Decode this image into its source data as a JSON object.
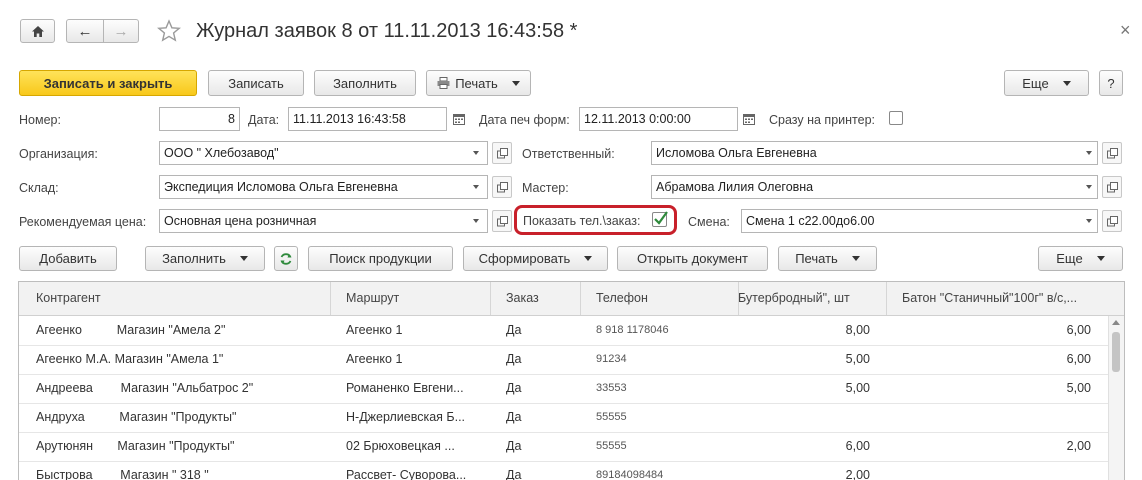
{
  "window": {
    "title": "Журнал заявок 8 от 11.11.2013 16:43:58 *",
    "close_glyph": "×",
    "back_glyph": "←",
    "forward_glyph": "→"
  },
  "toolbar": {
    "save_close": "Записать и закрыть",
    "save": "Записать",
    "fill": "Заполнить",
    "print": "Печать",
    "more": "Еще",
    "help": "?"
  },
  "form": {
    "number_label": "Номер:",
    "number_value": "8",
    "date_label": "Дата:",
    "date_value": "11.11.2013 16:43:58",
    "print_date_label": "Дата печ форм:",
    "print_date_value": "12.11.2013  0:00:00",
    "to_printer_label": "Сразу на принтер:",
    "org_label": "Организация:",
    "org_value": "ООО \" Хлебозавод\"",
    "responsible_label": "Ответственный:",
    "responsible_value": "Исломова Ольга Евгеневна",
    "warehouse_label": "Склад:",
    "warehouse_value": "Экспедиция Исломова Ольга Евгеневна",
    "master_label": "Мастер:",
    "master_value": "Абрамова Лилия Олеговна",
    "price_label": "Рекомендуемая цена:",
    "price_value": "Основная цена розничная",
    "show_phone_label": "Показать тел.\\заказ:",
    "shift_label": "Смена:",
    "shift_value": "Смена 1 с22.00до6.00"
  },
  "table_toolbar": {
    "add": "Добавить",
    "fill": "Заполнить",
    "search_products": "Поиск продукции",
    "generate": "Сформировать",
    "open_document": "Открыть документ",
    "print": "Печать",
    "more": "Еще"
  },
  "table": {
    "columns": [
      "Контрагент",
      "Маршрут",
      "Заказ",
      "Телефон",
      "Бутербродный\", шт",
      "Батон \"Станичный\"100г\" в/с,..."
    ],
    "rows": [
      {
        "contractor": "Агеенко          Магазин \"Амела 2\"",
        "route": "Агеенко 1",
        "order": "Да",
        "phone": "8 918 1178046",
        "c1": "8,00",
        "c2": "6,00"
      },
      {
        "contractor": "Агеенко М.А. Магазин \"Амела 1\"",
        "route": "Агеенко 1",
        "order": "Да",
        "phone": "91234",
        "c1": "5,00",
        "c2": "6,00"
      },
      {
        "contractor": "Андреева        Магазин \"Альбатрос 2\"",
        "route": "Романенко Евгени...",
        "order": "Да",
        "phone": "33553",
        "c1": "5,00",
        "c2": "5,00"
      },
      {
        "contractor": "Андруха          Магазин \"Продукты\"",
        "route": "Н-Джерлиевская Б...",
        "order": "Да",
        "phone": "55555",
        "c1": "",
        "c2": ""
      },
      {
        "contractor": "Арутюнян       Магазин \"Продукты\"",
        "route": "02 Брюховецкая   ...",
        "order": "Да",
        "phone": "55555",
        "c1": "6,00",
        "c2": "2,00"
      },
      {
        "contractor": "Быстрова        Магазин \" 318 \"",
        "route": "Рассвет- Суворова...",
        "order": "Да",
        "phone": "89184098484",
        "c1": "2,00",
        "c2": ""
      }
    ]
  }
}
